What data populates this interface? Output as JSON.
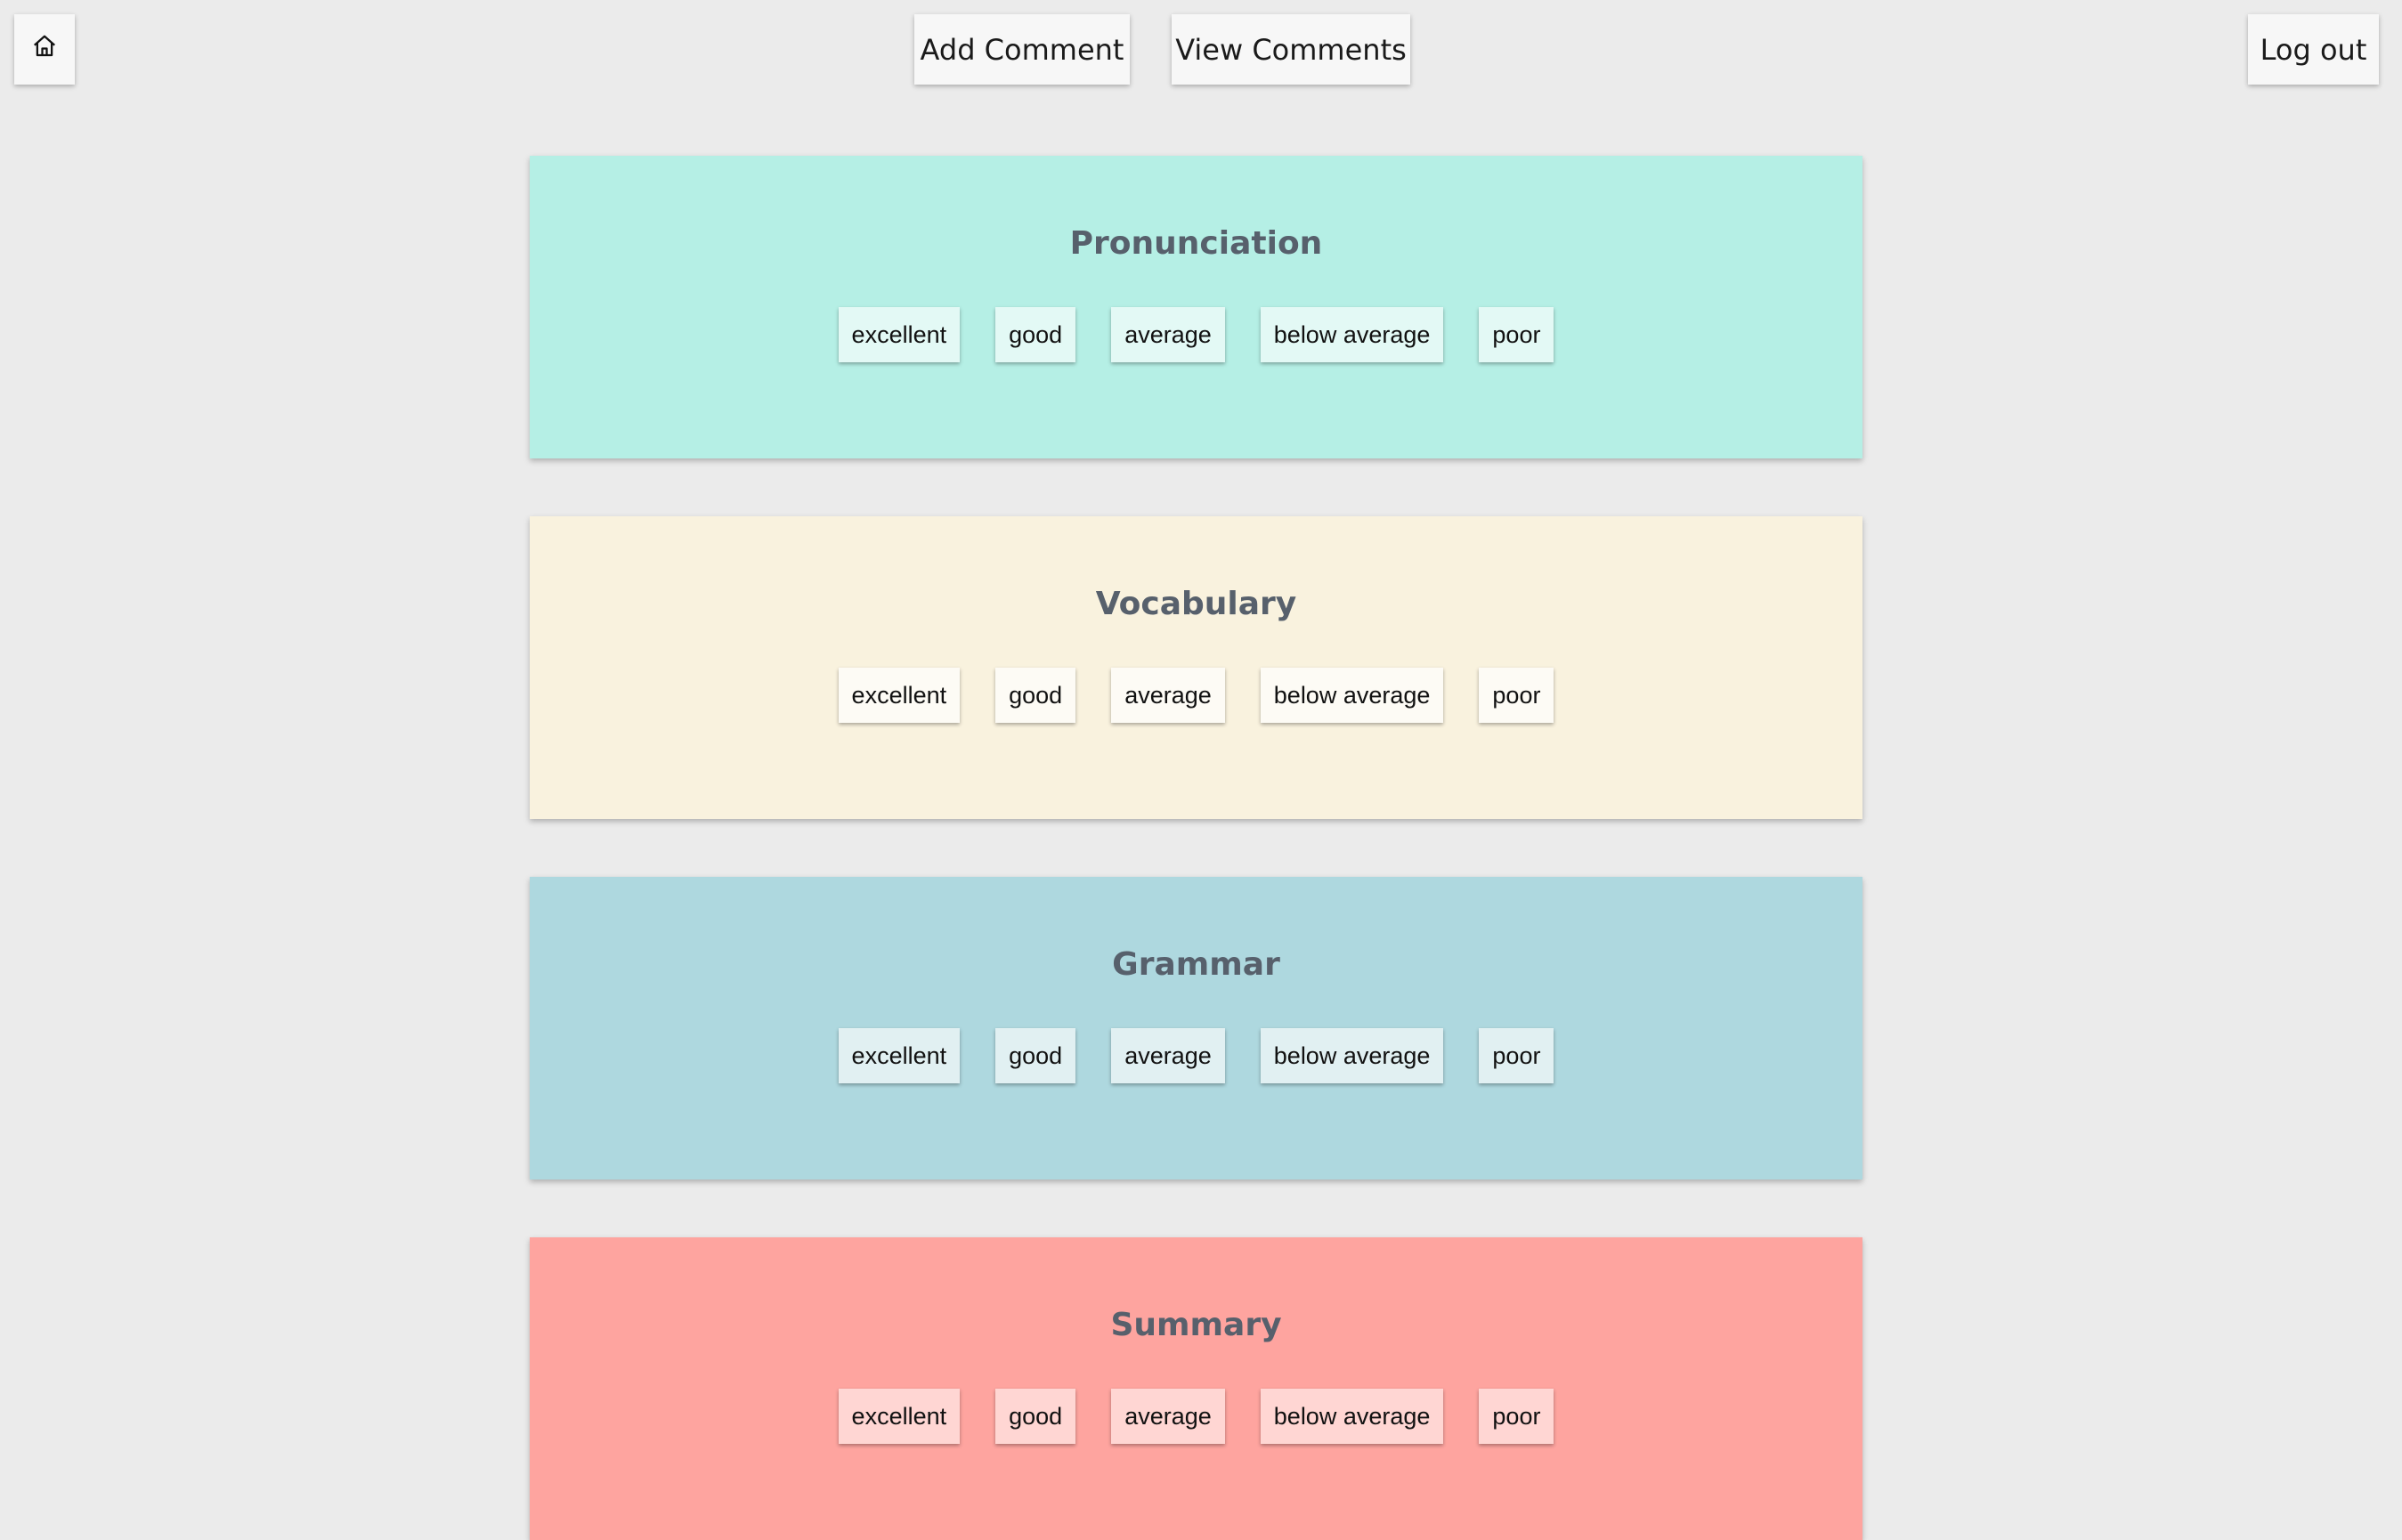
{
  "nav": {
    "home_icon": "home-icon",
    "add_comment": "Add Comment",
    "view_comments": "View Comments",
    "logout": "Log out"
  },
  "cards": [
    {
      "title": "Pronunciation",
      "bg": "#b5efe5",
      "btn_bg": "#e3f9f5",
      "options": [
        "excellent",
        "good",
        "average",
        "below average",
        "poor"
      ]
    },
    {
      "title": "Vocabulary",
      "bg": "#f9f2de",
      "btn_bg": "#fdfbf5",
      "options": [
        "excellent",
        "good",
        "average",
        "below average",
        "poor"
      ]
    },
    {
      "title": "Grammar",
      "bg": "#aed8df",
      "btn_bg": "#e1f0f2",
      "options": [
        "excellent",
        "good",
        "average",
        "below average",
        "poor"
      ]
    },
    {
      "title": "Summary",
      "bg": "#fea49f",
      "btn_bg": "#ffd6d3",
      "options": [
        "excellent",
        "good",
        "average",
        "below average",
        "poor"
      ]
    }
  ]
}
